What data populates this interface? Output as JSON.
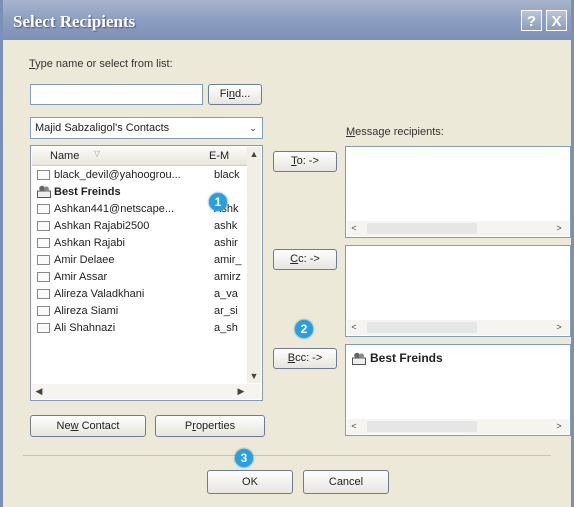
{
  "window": {
    "title": "Select Recipients",
    "help_glyph": "?",
    "close_glyph": "X"
  },
  "search": {
    "label_prefix": "T",
    "label_rest": "ype name or select from list:",
    "value": "",
    "find_prefix": "Fi",
    "find_u": "n",
    "find_rest": "d..."
  },
  "address_book": {
    "selected": "Majid Sabzaligol's Contacts",
    "arrow": "⌄"
  },
  "list": {
    "col_name": "Name",
    "col_sort": "▽",
    "col_email": "E-M",
    "rows": [
      {
        "name": "black_devil@yahoogrou...",
        "email": "black",
        "bold": false,
        "group": false
      },
      {
        "name": "Best Freinds",
        "email": "",
        "bold": true,
        "group": true
      },
      {
        "name": "Ashkan441@netscape...",
        "email": "Ashk",
        "bold": false,
        "group": false
      },
      {
        "name": "Ashkan Rajabi2500",
        "email": "ashk",
        "bold": false,
        "group": false
      },
      {
        "name": "Ashkan Rajabi",
        "email": "ashir",
        "bold": false,
        "group": false
      },
      {
        "name": "Amir Delaee",
        "email": "amir_",
        "bold": false,
        "group": false
      },
      {
        "name": "Amir Assar",
        "email": "amirz",
        "bold": false,
        "group": false
      },
      {
        "name": "Alireza Valadkhani",
        "email": "a_va",
        "bold": false,
        "group": false
      },
      {
        "name": "Alireza Siami",
        "email": "ar_si",
        "bold": false,
        "group": false
      },
      {
        "name": "Ali Shahnazi",
        "email": "a_sh",
        "bold": false,
        "group": false
      }
    ]
  },
  "buttons": {
    "to_u": "T",
    "to_rest": "o: ->",
    "cc_u": "C",
    "cc_rest": "c: ->",
    "bcc_u": "B",
    "bcc_rest": "cc: ->",
    "new_contact_a": "Ne",
    "new_contact_u": "w",
    "new_contact_b": " Contact",
    "properties_a": "P",
    "properties_u": "r",
    "properties_b": "operties",
    "ok": "OK",
    "cancel": "Cancel"
  },
  "recipients": {
    "label_u": "M",
    "label_rest": "essage recipients:",
    "bcc_item": "Best Freinds"
  },
  "markers": {
    "m1": "1",
    "m2": "2",
    "m3": "3"
  },
  "colors": {
    "title_bar": "#8ea0c2",
    "dialog_bg": "#ece9d8",
    "marker": "#27a0df"
  }
}
